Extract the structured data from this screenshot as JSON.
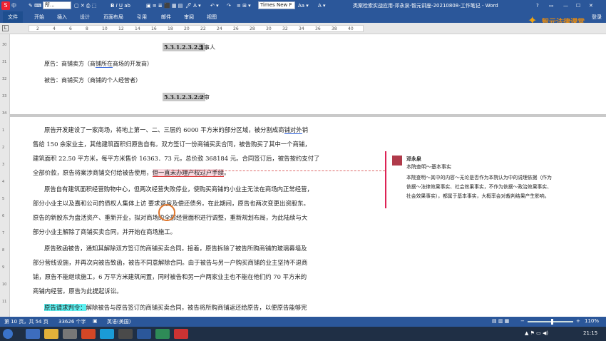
{
  "window": {
    "title": "类案检索实战应用-邓永泉-智元讲座-20210808-工作笔记 - Word",
    "sogou_label": "中",
    "font_name_combo": "Times New F",
    "font_style_combo": "所...",
    "aa_label": "Aa",
    "help_icon": "?",
    "login_label": "登录"
  },
  "ribbon": {
    "file_label": "文件",
    "tabs": [
      "开始",
      "插入",
      "设计",
      "页面布局",
      "引用",
      "邮件",
      "审阅",
      "视图"
    ]
  },
  "ruler": {
    "ticks": [
      "2",
      "4",
      "6",
      "8",
      "10",
      "12",
      "14",
      "16",
      "18",
      "20",
      "22",
      "24",
      "26",
      "28",
      "30",
      "32",
      "34",
      "36",
      "38",
      "40"
    ]
  },
  "vruler": {
    "ticks": [
      "30",
      "31",
      "32",
      "33",
      "34",
      "1",
      "2",
      "3",
      "4",
      "5",
      "6",
      "7",
      "8",
      "9",
      "10",
      "11"
    ]
  },
  "logo": {
    "text": "智元法律课堂"
  },
  "doc": {
    "heading1": {
      "number": "5.3.1.2.3.2.1",
      "text": " 当事人"
    },
    "plaintiff_line": {
      "label": "原告：商铺卖方（商",
      "ul": "铺所在",
      "rest": "商场的开发商）"
    },
    "defendant_line": "被告：商铺买方（商铺的个人经营者）",
    "heading2": {
      "number": "5.3.1.2.3.2.2",
      "text": " 一审"
    },
    "p1": [
      {
        "text": "原告开发建设了一家商场，将地上第一、二、三层约 6000 平方米的部分区域，被分割成商",
        "ul": "铺对外",
        "tail": "销"
      },
      {
        "text": "售给 150 余家业主，其他建筑面积归原告自有。双方签订一份商铺买卖合同，被告购买了其中一个商铺，",
        "ul": "",
        "tail": ""
      },
      {
        "text": "建筑面积 22.50 平方米，每平方米售价 16363．73 元，总价款 368184 元。合同签订后，被告按约支付了",
        "ul": "",
        "tail": ""
      },
      {
        "text": "全部价款，原告将案涉商铺交付给被告使用，",
        "hl": "但一直未办理产权过户手续",
        "tail": "。"
      }
    ],
    "p2": [
      "原告自有建筑面积经营购物中心，但两次经营失败停业，使购买商铺的小业主无法在商场内正常经营，",
      "部分小业主以及嘉和公司的债权人集体上访 要求退房及偿还债务。在此期间，原告也两次变更出资股东。",
      "原告的新股东为盘活资产、重新开业，拟对商场的全部经营面积进行调整，重新规划布局，为此陆续与大",
      "部分小业主解除了商铺买卖合同，并开始在商场施工。"
    ],
    "p3": [
      "原告致函被告，通知其解除双方签订的商铺买卖合同。接着，原告拆除了被告所购商铺的玻璃幕墙及",
      "部分营线设施，并再次向被告致函，被告不同意解除合同。由于被告与另一户购买商铺的业主坚持不退商",
      "铺，原告不能继续施工，6 万平方米建筑闲置，同时被告和另一户两家业主也不能在他们约 70 平方米的",
      "商铺内经营。原告为此提起诉讼。"
    ],
    "p4": {
      "hl": "原告请求判令：",
      "text": "解除被告与原告签订的商铺买卖合同，被告将所购商铺返还给原告，以便原告能够完"
    }
  },
  "comment": {
    "author": "邓永泉",
    "title_line": "本院查明～基本事实",
    "body": [
      "本院查明～其中的内容～无论是否作为本院认为中的说理依据（作为",
      "依据～法律效果事实、社会效果事实，不作为依据～政治效果事实、",
      "社会效果事实），都属于基本事实，大概率会对裁判结果产生影响。"
    ]
  },
  "status": {
    "page": "第 10 页，共 54 页",
    "words": "33626 个字",
    "language": "英语(美国)",
    "zoom": "110%"
  },
  "taskbar": {
    "clock": "21:15"
  },
  "colors": {
    "ribbon_blue": "#2b579a",
    "comment_red": "#d25",
    "highlight_cyan": "#5ef0f0",
    "cursor_orange": "#e0762b"
  }
}
